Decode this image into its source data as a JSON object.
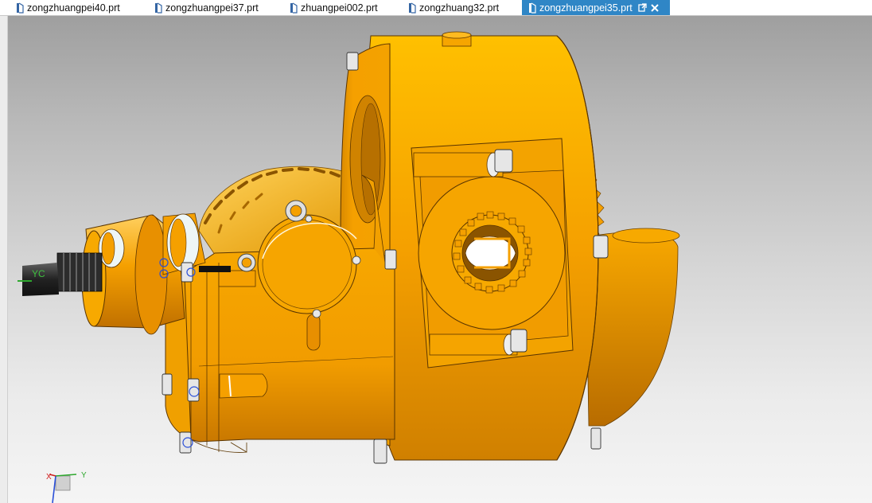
{
  "tabs": [
    {
      "label": "zongzhuangpei40.prt",
      "active": false
    },
    {
      "label": "zongzhuangpei37.prt",
      "active": false
    },
    {
      "label": "zhuangpei002.prt",
      "active": false
    },
    {
      "label": "zongzhuang32.prt",
      "active": false
    },
    {
      "label": "zongzhuangpei35.prt",
      "active": true
    }
  ],
  "viewport": {
    "wcs_label": "YC",
    "triad": {
      "x_label": "X",
      "y_label": "Y"
    }
  },
  "colors": {
    "part_orange": "#f5a000",
    "shadow_orange": "#c87800",
    "tab_active_bg": "#2f86c6"
  },
  "icons": {
    "part_file": "part-file-icon",
    "tab_float": "float-window-icon",
    "tab_close": "close-icon"
  }
}
